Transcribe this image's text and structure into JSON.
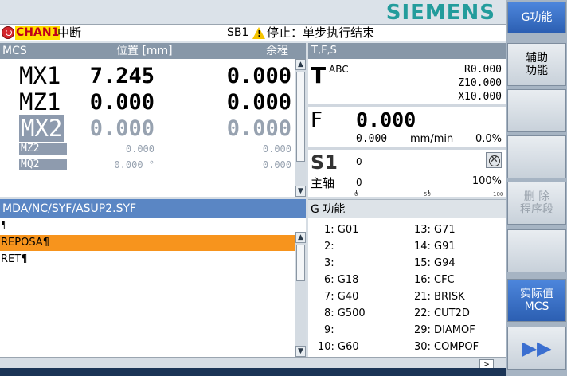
{
  "header": {
    "logo": "SIEMENS",
    "channel": "CHAN1",
    "channel_state": "中断",
    "sb_label": "SB1",
    "status_message": "停止：单步执行结束"
  },
  "axes": {
    "header": {
      "coord_system": "MCS",
      "position_label": "位置 [mm]",
      "distance_label": "余程"
    },
    "rows": [
      {
        "name": "MX1",
        "position": "7.245",
        "distance": "0.000",
        "style": "big"
      },
      {
        "name": "MZ1",
        "position": "0.000",
        "distance": "0.000",
        "style": "big"
      },
      {
        "name": "MX2",
        "position": "0.000",
        "distance": "0.000",
        "style": "big-gray"
      },
      {
        "name": "MZ2",
        "position": "0.000",
        "distance": "0.000",
        "style": "small"
      },
      {
        "name": "MQ2",
        "position": "0.000 °",
        "distance": "0.000",
        "style": "small"
      }
    ]
  },
  "tfs": {
    "header": "T,F,S",
    "tool": {
      "letter": "T",
      "name": "ABC",
      "values": [
        "R0.000",
        "Z10.000",
        "X10.000"
      ]
    },
    "feed": {
      "letter": "F",
      "value": "0.000",
      "value_small": "0.000",
      "unit": "mm/min",
      "override": "0.0%"
    },
    "spindle": {
      "letter": "S1",
      "value": "0",
      "label": "主轴",
      "value2": "0",
      "override": "100%",
      "bar_ticks": [
        "0",
        "50",
        "100"
      ]
    }
  },
  "program": {
    "path": "MDA/NC/SYF/ASUP2.SYF",
    "lines": [
      "¶",
      "REPOSA¶",
      "RET¶"
    ],
    "active_line": 1
  },
  "gfunctions": {
    "title": "G 功能",
    "left": [
      "1: G01",
      "2:",
      "3:",
      "6: G18",
      "7: G40",
      "8: G500",
      "9:",
      "10: G60"
    ],
    "right": [
      "13: G71",
      "14: G91",
      "15: G94",
      "16: CFC",
      "21: BRISK",
      "22: CUT2D",
      "29: DIAMOF",
      "30: COMPOF"
    ]
  },
  "softkeys": {
    "g_functions": "G功能",
    "aux_functions": "辅助\n功能",
    "delete_block": "删 除\n程序段",
    "actual_value": "实际值\nMCS"
  },
  "bottom": {
    "next_label": ">"
  },
  "colors": {
    "logo": "#239c9c",
    "panel_header": "#8797a8",
    "program_header": "#5a86c4",
    "active_line": "#f7941d",
    "softkey_active": "#2c5fb2",
    "channel_badge": "#ffe000",
    "channel_text": "#c0001a"
  }
}
